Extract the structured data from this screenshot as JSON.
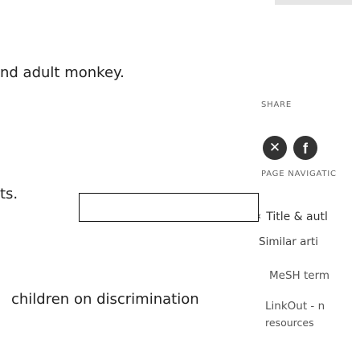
{
  "article": {
    "line1": "nd adult monkey.",
    "line2": "ts.",
    "line3": "children on discrimination"
  },
  "sidebar": {
    "share_label": "SHARE",
    "share_icons": [
      "x-icon",
      "facebook-icon"
    ],
    "x_glyph": "✕",
    "fb_glyph": "f",
    "page_navigation_label": "PAGE NAVIGATIC",
    "nav_selected": "Title & autl",
    "nav_chevron": "‹",
    "links": {
      "similar": "Similar arti",
      "mesh": "MeSH term",
      "linkout": "LinkOut - n",
      "resources": "resources"
    }
  },
  "colors": {
    "text": "#222222",
    "muted": "#666666",
    "icon_bg": "#333333",
    "border": "#111111"
  }
}
